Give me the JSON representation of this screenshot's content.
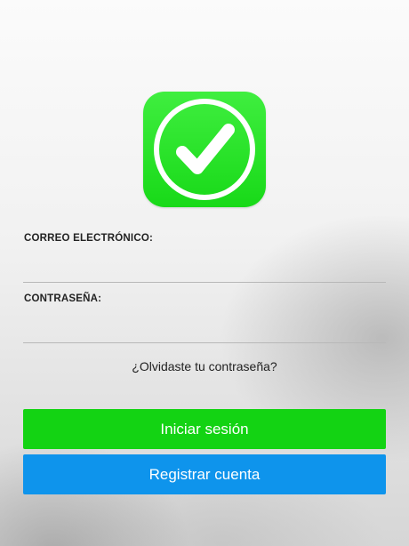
{
  "colors": {
    "logo_green": "#22dd22",
    "login_button": "#13d313",
    "register_button": "#0e94ec"
  },
  "logo": {
    "icon": "checkmark-icon"
  },
  "form": {
    "email_label": "CORREO ELECTRÓNICO:",
    "email_value": "",
    "password_label": "CONTRASEÑA:",
    "password_value": "",
    "forgot_password": "¿Olvidaste tu contraseña?"
  },
  "actions": {
    "login_label": "Iniciar sesión",
    "register_label": "Registrar cuenta"
  }
}
